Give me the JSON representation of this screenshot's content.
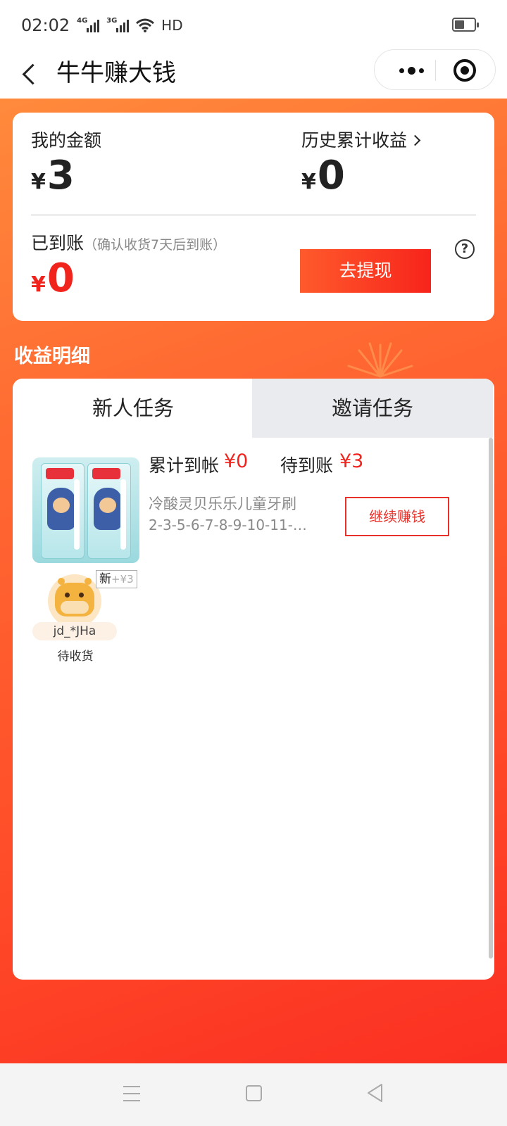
{
  "status_bar": {
    "time": "02:02",
    "signal1_tag": "4G",
    "signal2_tag": "3G",
    "hd_label": "HD",
    "battery_level": 0.5
  },
  "nav": {
    "title": "牛牛赚大钱"
  },
  "balance": {
    "my_amount_label": "我的金额",
    "my_amount_currency": "¥",
    "my_amount_value": "3",
    "history_label": "历史累计收益",
    "history_currency": "¥",
    "history_value": "0",
    "arrived_label": "已到账",
    "arrived_note": "（确认收货7天后到账）",
    "arrived_currency": "¥",
    "arrived_value": "0",
    "withdraw_button": "去提现",
    "help_glyph": "?"
  },
  "details": {
    "section_title": "收益明细",
    "tabs": [
      {
        "label": "新人任务",
        "selected": true
      },
      {
        "label": "邀请任务",
        "selected": false
      }
    ],
    "task": {
      "cumulative_label": "累计到帐",
      "cumulative_value": "¥0",
      "pending_label": "待到账",
      "pending_value": "¥3",
      "product_name": "冷酸灵贝乐乐儿童牙刷",
      "product_sizes": "2-3-5-6-7-8-9-10-11-12...",
      "earn_button": "继续赚钱"
    },
    "invitees": [
      {
        "name": "jd_*JHa",
        "status": "待收货",
        "badge_new": "新",
        "badge_amount": "+¥3"
      }
    ]
  },
  "colors": {
    "accent_red": "#f0231d",
    "bg_orange_top": "#ff8a3c",
    "bg_red_bottom": "#fb2f22"
  }
}
